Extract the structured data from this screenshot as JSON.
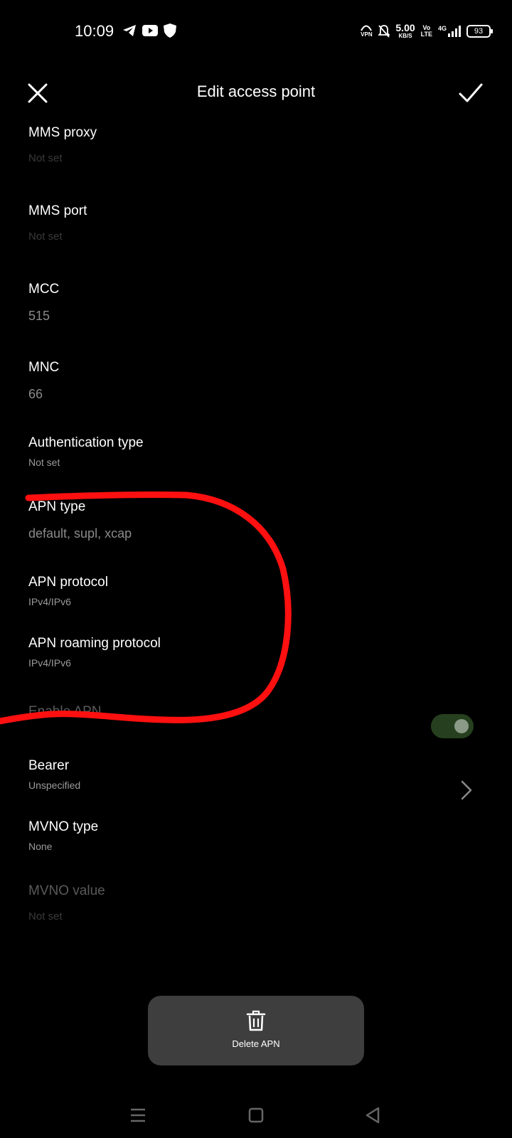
{
  "status_bar": {
    "time": "10:09",
    "vpn_label": "VPN",
    "speed_value": "5.00",
    "speed_unit": "KB/S",
    "volte_top": "Vo",
    "volte_bottom": "LTE",
    "network": "4G",
    "battery": "93"
  },
  "header": {
    "title": "Edit access point"
  },
  "fields": [
    {
      "label": "MMS proxy",
      "value": "Not set"
    },
    {
      "label": "MMS port",
      "value": "Not set"
    },
    {
      "label": "MCC",
      "value": "515"
    },
    {
      "label": "MNC",
      "value": "66"
    },
    {
      "label": "Authentication type",
      "value": "Not set"
    },
    {
      "label": "APN type",
      "value": "default, supl, xcap"
    },
    {
      "label": "APN protocol",
      "value": "IPv4/IPv6"
    },
    {
      "label": "APN roaming protocol",
      "value": "IPv4/IPv6"
    },
    {
      "label": "Enable APN",
      "enabled": true
    },
    {
      "label": "Bearer",
      "value": "Unspecified"
    },
    {
      "label": "MVNO type",
      "value": "None"
    },
    {
      "label": "MVNO value",
      "value": "Not set"
    }
  ],
  "delete_button": {
    "label": "Delete APN"
  },
  "colors": {
    "background": "#000000",
    "annotation": "#ff1010",
    "toggle_track": "#26401f",
    "button_bg": "#3e3e3e"
  }
}
